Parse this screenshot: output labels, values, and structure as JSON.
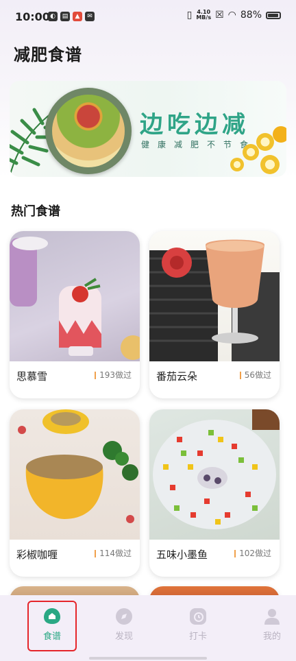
{
  "status_bar": {
    "time": "10:00",
    "net_speed_value": "4.10",
    "net_speed_unit": "MB/s",
    "battery": "88%"
  },
  "page_title": "减肥食谱",
  "banner": {
    "headline": "边吃边减",
    "subtitle": "健康减肥不节食"
  },
  "section_title": "热门食谱",
  "recipes": [
    {
      "name": "思慕雪",
      "count": "193做过"
    },
    {
      "name": "番茄云朵",
      "count": "56做过"
    },
    {
      "name": "彩椒咖喱",
      "count": "114做过"
    },
    {
      "name": "五味小墨鱼",
      "count": "102做过"
    }
  ],
  "tabs": [
    {
      "label": "食谱",
      "icon": "recipe-icon",
      "active": true
    },
    {
      "label": "发现",
      "icon": "compass-icon",
      "active": false
    },
    {
      "label": "打卡",
      "icon": "clock-icon",
      "active": false
    },
    {
      "label": "我的",
      "icon": "user-icon",
      "active": false
    }
  ],
  "colors": {
    "accent": "#2aa884",
    "banner_text": "#2fa487",
    "highlight": "#e5252a",
    "count_marker": "#f0a04b"
  }
}
